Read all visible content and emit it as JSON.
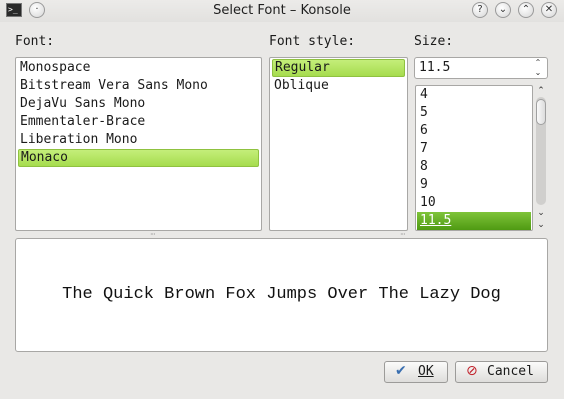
{
  "window": {
    "title": "Select Font – Konsole",
    "app_icon": "terminal-icon",
    "controls": [
      "help-icon",
      "minimize-icon",
      "maximize-icon",
      "close-icon"
    ]
  },
  "font": {
    "label": "Font:",
    "items": [
      "Monospace",
      "Bitstream Vera Sans Mono",
      "DejaVu Sans Mono",
      "Emmentaler-Brace",
      "Liberation Mono",
      "Monaco"
    ],
    "selected": "Monaco"
  },
  "style": {
    "label": "Font style:",
    "items": [
      "Regular",
      "Oblique"
    ],
    "selected": "Regular"
  },
  "size": {
    "label": "Size:",
    "value": "11.5",
    "items": [
      "4",
      "5",
      "6",
      "7",
      "8",
      "9",
      "10",
      "11.5"
    ],
    "selected": "11.5"
  },
  "preview": {
    "text": "The Quick Brown Fox Jumps Over The Lazy Dog"
  },
  "buttons": {
    "ok": "OK",
    "cancel": "Cancel"
  },
  "colors": {
    "selection": "#b5e462",
    "size_selection": "#5fa81e"
  }
}
